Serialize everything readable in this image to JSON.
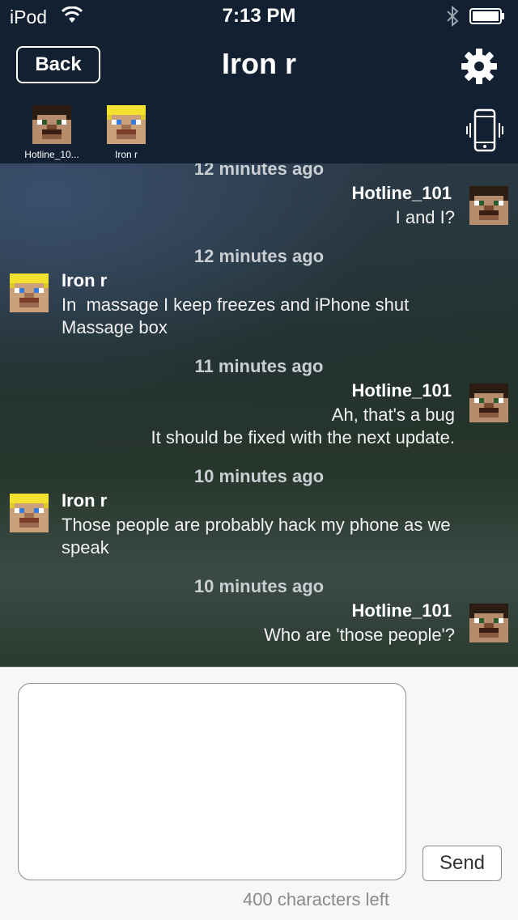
{
  "status_bar": {
    "device": "iPod",
    "time": "7:13 PM"
  },
  "header": {
    "back_label": "Back",
    "title": "Iron r"
  },
  "participants": [
    {
      "name": "Hotline_10...",
      "avatar": "steve-face-icon"
    },
    {
      "name": "Iron r",
      "avatar": "blonde-face-icon"
    }
  ],
  "messages": [
    {
      "timestamp": "12 minutes ago",
      "sender": "Hotline_101",
      "side": "right",
      "lines": [
        "I and I?"
      ]
    },
    {
      "timestamp": "12 minutes ago",
      "sender": "Iron r",
      "side": "left",
      "lines": [
        "In  massage I keep freezes and iPhone shut",
        "Massage box"
      ]
    },
    {
      "timestamp": "11 minutes ago",
      "sender": "Hotline_101",
      "side": "right",
      "lines": [
        "Ah, that's a bug",
        "It should be fixed with the next update."
      ]
    },
    {
      "timestamp": "10 minutes ago",
      "sender": "Iron r",
      "side": "left",
      "lines": [
        "Those people are probably hack my phone as we",
        "speak"
      ]
    },
    {
      "timestamp": "10 minutes ago",
      "sender": "Hotline_101",
      "side": "right",
      "lines": [
        "Who are 'those people'?"
      ]
    }
  ],
  "composer": {
    "value": "",
    "send_label": "Send",
    "chars_left": "400 characters left"
  },
  "icons": {
    "wifi": "wifi-icon",
    "bluetooth": "bluetooth-icon",
    "battery": "battery-icon",
    "settings": "gear-icon",
    "vibrate": "vibrate-phone-icon"
  },
  "colors": {
    "header_bg": "#122032",
    "composer_bg": "#f7f7f7"
  }
}
